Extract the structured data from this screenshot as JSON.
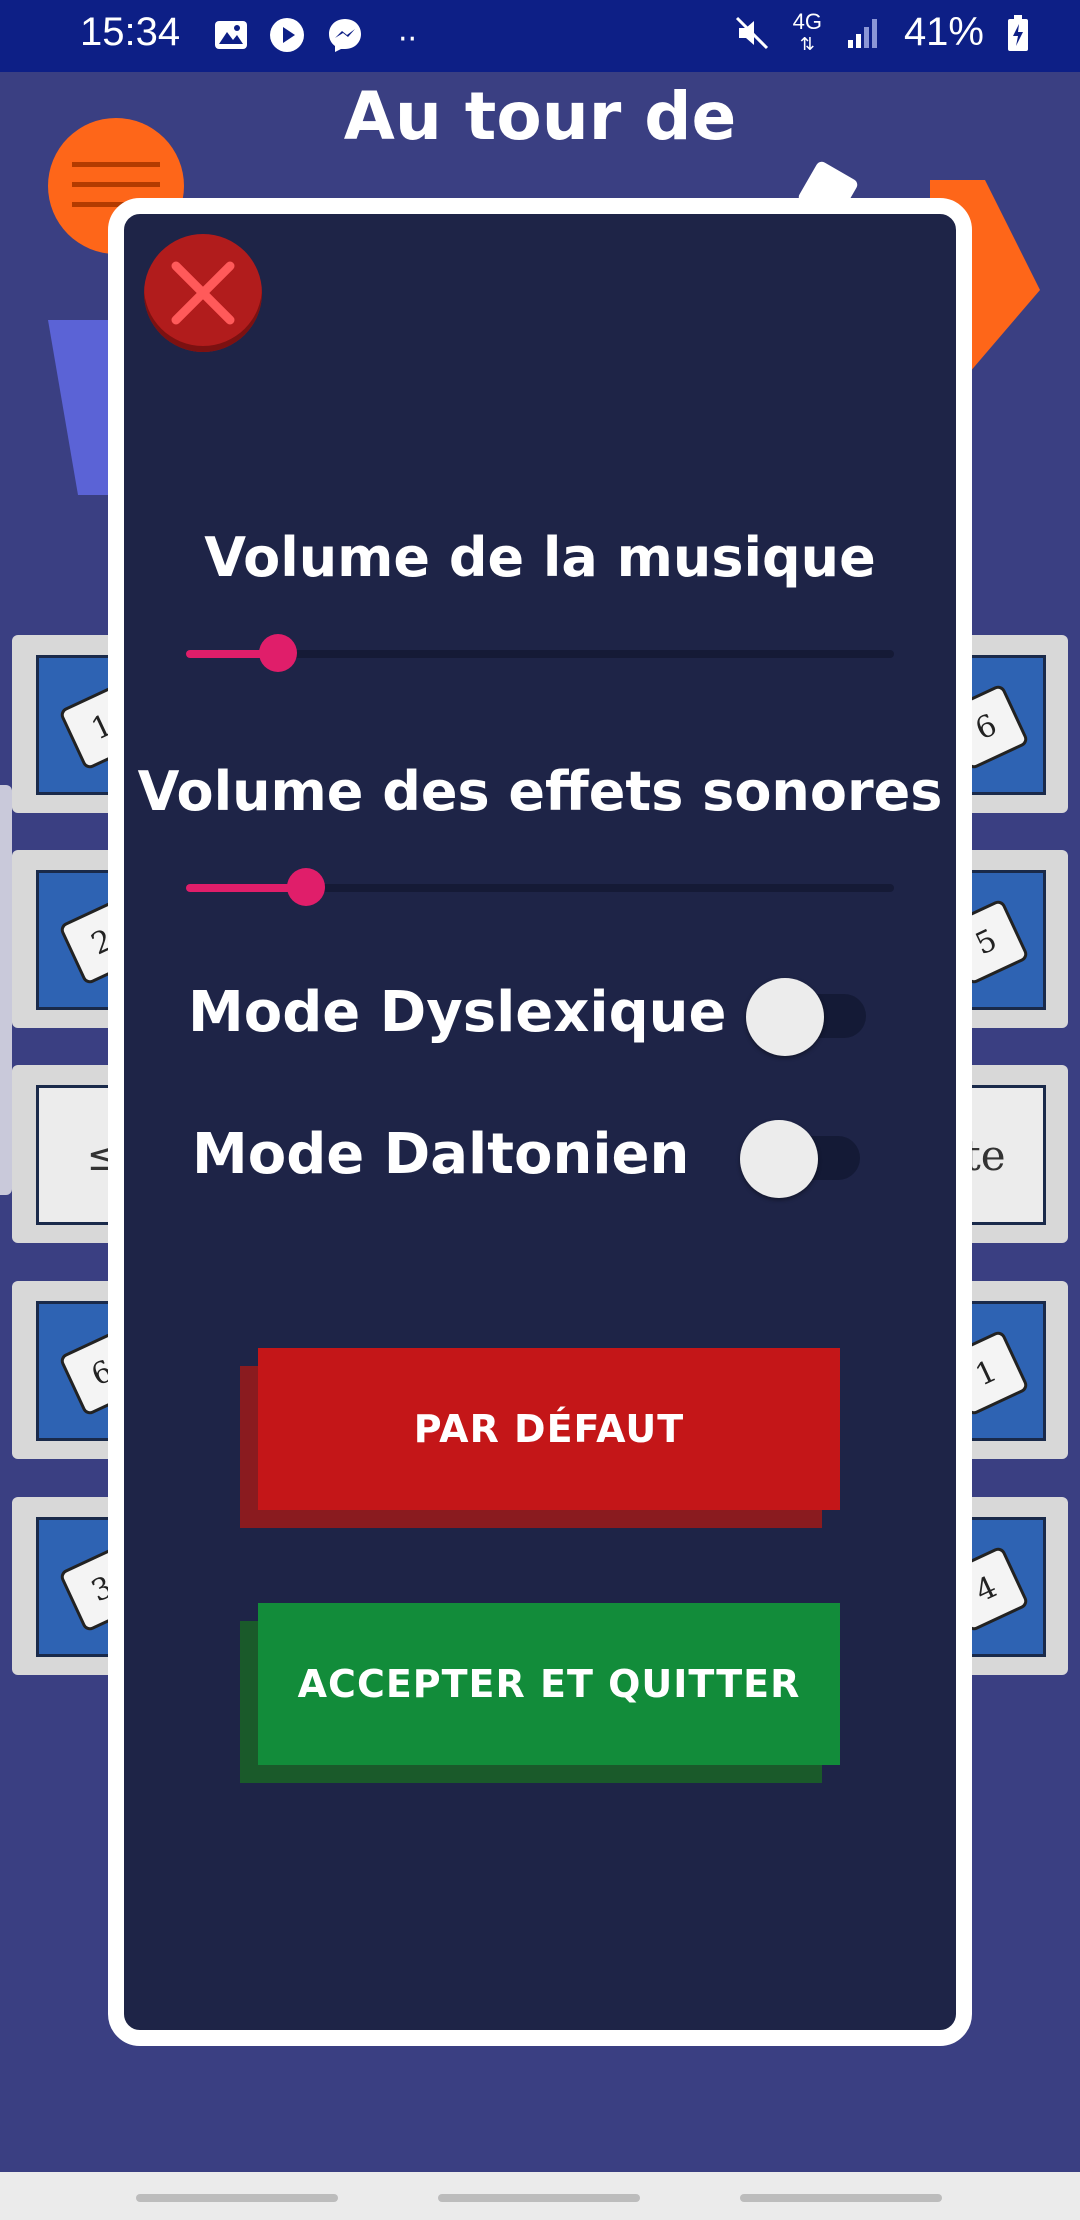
{
  "status_bar": {
    "time": "15:34",
    "battery": "41%",
    "network": "4G",
    "icons": [
      "gallery-icon",
      "play-icon",
      "messenger-icon",
      "more-dots-icon",
      "mute-icon",
      "network-icon",
      "signal-icon",
      "battery-icon"
    ]
  },
  "background": {
    "title": "Au tour de",
    "left_dice": [
      "1",
      "2",
      "≤",
      "6",
      "3"
    ],
    "right_dice": [
      "6",
      "5",
      "ite",
      "1",
      "4"
    ]
  },
  "settings": {
    "music_volume_label": "Volume de la musique",
    "music_volume": 0.13,
    "effects_volume_label": "Volume des effets sonores",
    "effects_volume": 0.17,
    "dyslexic_label": "Mode Dyslexique",
    "dyslexic_on": false,
    "colorblind_label": "Mode Daltonien",
    "colorblind_on": false,
    "default_button": "PAR DÉFAUT",
    "accept_button": "ACCEPTER ET QUITTER"
  },
  "colors": {
    "accent": "#e01e6a",
    "modal_bg": "#1e2447",
    "default_button": "#c41618",
    "accept_button": "#128c3a",
    "close_button": "#b11c1c"
  }
}
